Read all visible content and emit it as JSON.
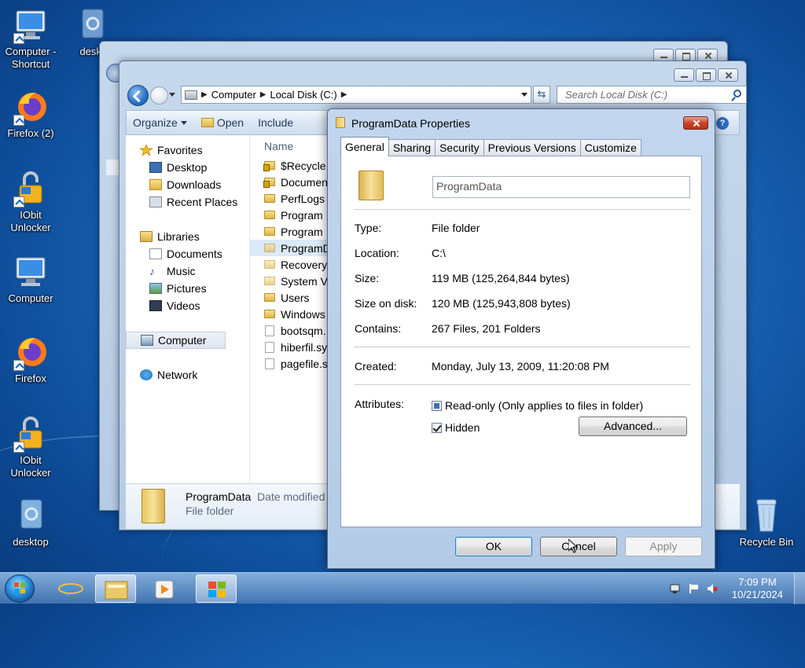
{
  "desktop": {
    "icons": [
      {
        "label": "Computer - Shortcut"
      },
      {
        "label": "deskt"
      },
      {
        "label": "Firefox (2)"
      },
      {
        "label": "IObit Unlocker"
      },
      {
        "label": "Computer"
      },
      {
        "label": "Firefox"
      },
      {
        "label": "IObit Unlocker"
      },
      {
        "label": "desktop"
      },
      {
        "label": "Recycle Bin"
      }
    ]
  },
  "explorer": {
    "address": {
      "root": "Computer",
      "drive": "Local Disk (C:)"
    },
    "search_placeholder": "Search Local Disk (C:)",
    "commands": {
      "organize": "Organize",
      "open": "Open",
      "include": "Include"
    },
    "nav": {
      "favorites": "Favorites",
      "desktop": "Desktop",
      "downloads": "Downloads",
      "recent": "Recent Places",
      "libraries": "Libraries",
      "documents": "Documents",
      "music": "Music",
      "pictures": "Pictures",
      "videos": "Videos",
      "computer": "Computer",
      "network": "Network"
    },
    "column_name": "Name",
    "files": [
      "$Recycle",
      "Documen",
      "PerfLogs",
      "Program",
      "Program",
      "ProgramD",
      "Recovery",
      "System V",
      "Users",
      "Windows",
      "bootsqm.",
      "hiberfil.sy",
      "pagefile.s"
    ],
    "details": {
      "name": "ProgramData",
      "date_label": "Date modified",
      "type": "File folder"
    }
  },
  "dialog": {
    "title": "ProgramData Properties",
    "tabs": [
      "General",
      "Sharing",
      "Security",
      "Previous Versions",
      "Customize"
    ],
    "name_value": "ProgramData",
    "fields": {
      "type_label": "Type:",
      "type_value": "File folder",
      "location_label": "Location:",
      "location_value": "C:\\",
      "size_label": "Size:",
      "size_value": "119 MB (125,264,844 bytes)",
      "sizeondisk_label": "Size on disk:",
      "sizeondisk_value": "120 MB (125,943,808 bytes)",
      "contains_label": "Contains:",
      "contains_value": "267 Files, 201 Folders",
      "created_label": "Created:",
      "created_value": "Monday, July 13, 2009, 11:20:08 PM",
      "attributes_label": "Attributes:",
      "readonly_label": "Read-only (Only applies to files in folder)",
      "hidden_label": "Hidden",
      "advanced_label": "Advanced..."
    },
    "buttons": {
      "ok": "OK",
      "cancel": "Cancel",
      "apply": "Apply"
    }
  },
  "taskbar": {
    "time": "7:09 PM",
    "date": "10/21/2024"
  }
}
